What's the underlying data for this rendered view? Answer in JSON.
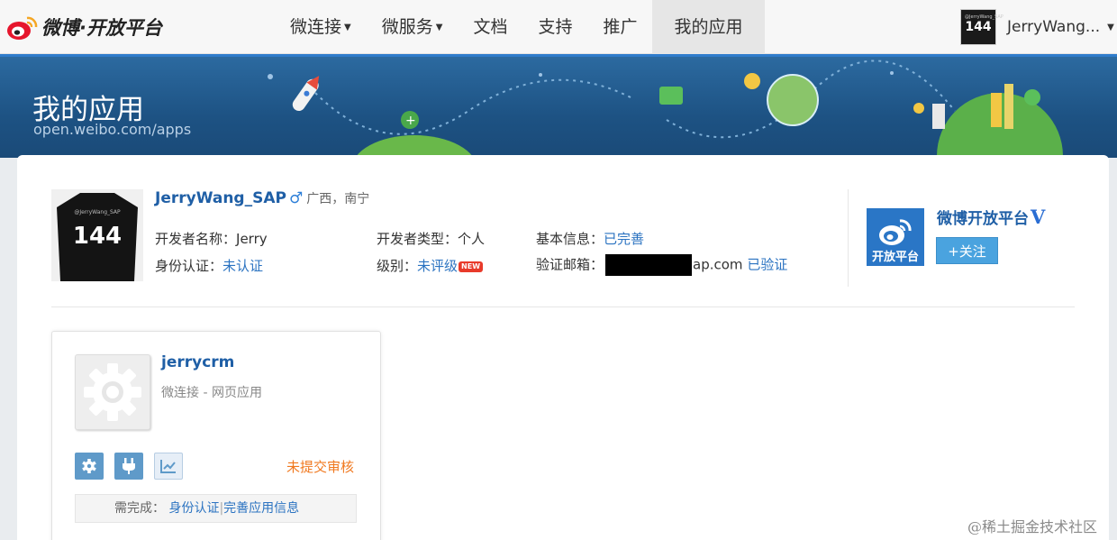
{
  "header": {
    "logo_text": "微博·开放平台",
    "nav": [
      {
        "label": "微连接",
        "has_menu": true
      },
      {
        "label": "微服务",
        "has_menu": true
      },
      {
        "label": "文档",
        "has_menu": false
      },
      {
        "label": "支持",
        "has_menu": false
      },
      {
        "label": "推广",
        "has_menu": false
      },
      {
        "label": "我的应用",
        "has_menu": false,
        "active": true
      }
    ],
    "user": {
      "avatar_number": "144",
      "avatar_caption": "@JerryWang_SAP",
      "name": "JerryWang..."
    }
  },
  "banner": {
    "title": "我的应用",
    "subtitle": "open.weibo.com/apps"
  },
  "profile": {
    "avatar_caption": "@JerryWang_SAP",
    "avatar_number": "144",
    "name": "JerryWang_SAP",
    "gender_symbol": "♂",
    "location": "广西，南宁",
    "developer_name_label": "开发者名称：",
    "developer_name": "Jerry",
    "developer_type_label": "开发者类型：",
    "developer_type": "个人",
    "basic_info_label": "基本信息：",
    "basic_info_value": "已完善",
    "identity_label": "身份认证：",
    "identity_value": "未认证",
    "level_label": "级别：",
    "level_value": "未评级",
    "level_badge": "NEW",
    "email_label": "验证邮箱：",
    "email_suffix": "ap.com",
    "email_status": "已验证"
  },
  "platform": {
    "logo_text": "开放平台",
    "name": "微博开放平台",
    "verified_mark": "V",
    "follow_label": "+关注"
  },
  "app": {
    "name": "jerrycrm",
    "type": "微连接 - 网页应用",
    "tools": [
      "gear-icon",
      "plug-icon",
      "chart-icon"
    ],
    "status": "未提交审核",
    "todo_label": "需完成：",
    "todo_items": [
      "身份认证",
      "完善应用信息"
    ]
  },
  "watermark": "@稀土掘金技术社区",
  "colors": {
    "link": "#2b73c1",
    "brand_blue": "#1f5fa6",
    "status_orange": "#f0781e",
    "banner": "#1d5283",
    "follow": "#4aa3df"
  }
}
